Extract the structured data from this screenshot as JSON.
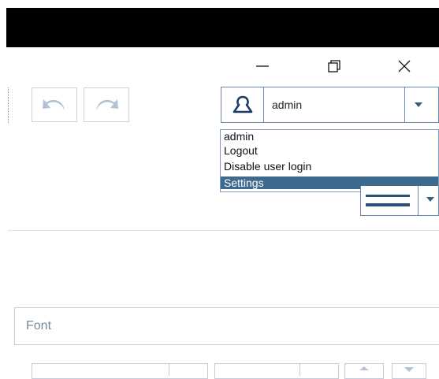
{
  "window": {
    "minimize_icon": "minimize-icon",
    "maximize_icon": "restore-icon",
    "close_icon": "close-icon"
  },
  "toolbar": {
    "undo_icon": "undo-icon",
    "redo_icon": "redo-icon"
  },
  "user_menu": {
    "current_user": "admin",
    "icon": "user-icon",
    "items": [
      {
        "label": "admin",
        "selected": false
      },
      {
        "label": "Logout",
        "selected": false
      },
      {
        "label": "Disable user login",
        "selected": false
      },
      {
        "label": "Settings",
        "selected": true
      }
    ]
  },
  "font_group": {
    "label": "Font"
  },
  "colors": {
    "accent": "#3e6a8e",
    "border": "#6c87a6"
  }
}
